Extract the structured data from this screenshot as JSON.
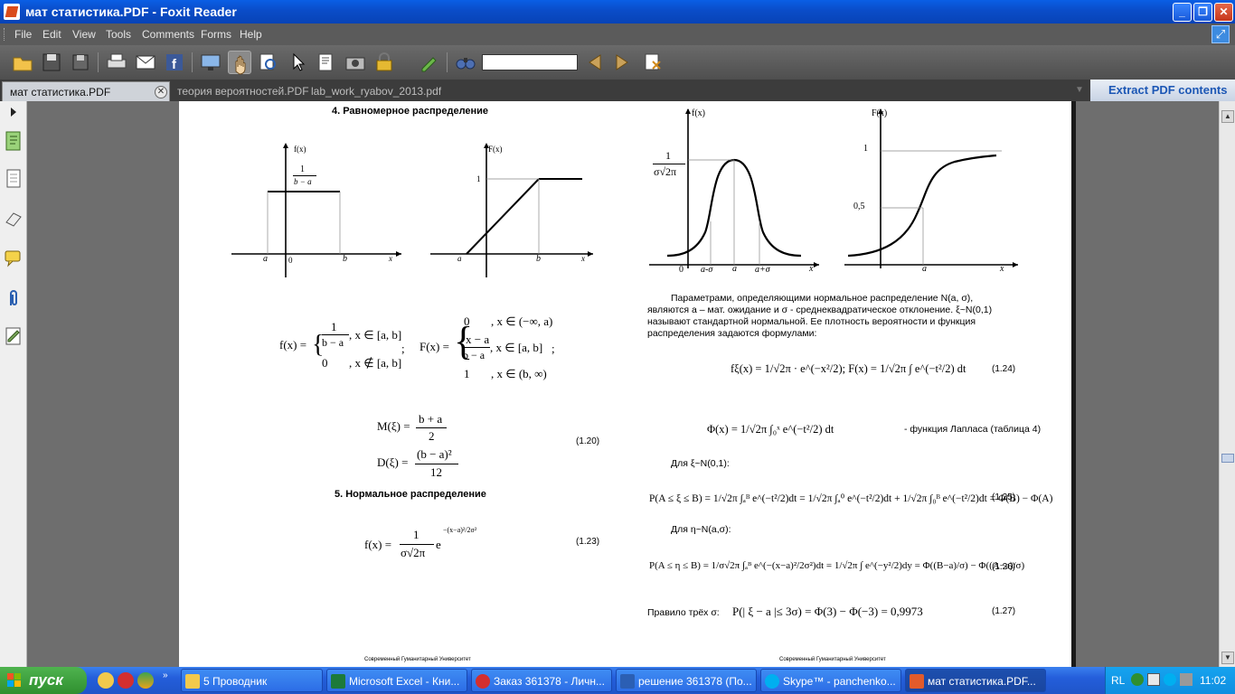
{
  "window": {
    "title": "мат статистика.PDF - Foxit Reader",
    "minimize": "_",
    "maximize": "❐",
    "close": "✕"
  },
  "menu": [
    "File",
    "Edit",
    "View",
    "Tools",
    "Comments",
    "Forms",
    "Help"
  ],
  "toolbar": {
    "find_value": ""
  },
  "tabs": [
    {
      "label": "мат статистика.PDF",
      "active": true
    },
    {
      "label": "теория вероятностей.PDF",
      "active": false
    },
    {
      "label": "lab_work_ryabov_2013.pdf",
      "active": false
    }
  ],
  "extract_label": "Extract PDF contents",
  "doc": {
    "h4": "4.  Равномерное  распределение",
    "h5": "5.  Нормальное  распределение",
    "u_fx_label": "f(x)",
    "u_Fx_label": "F(x)",
    "u_frac": "1",
    "u_frac_den": "b − a",
    "u_a": "a",
    "u_0": "0",
    "u_b": "b",
    "u_x": "x",
    "u_1": "1",
    "u_a2": "a",
    "u_b2": "b",
    "u_x2": "x",
    "f_def": "f(x) =",
    "f_case1": "1",
    "f_case1_den": "b − a",
    "f_case1_cond": ", x ∈ [a, b]",
    "f_case2": "0",
    "f_case2_cond": ", x ∉ [a, b]",
    "f_semicolon": ";",
    "F_def": "F(x) =",
    "F_case1": "0",
    "F_case1_cond": ", x ∈ (−∞, a)",
    "F_case2_num": "x − a",
    "F_case2_den": "b − a",
    "F_case2_cond": ", x ∈ [a, b]",
    "F_case3": "1",
    "F_case3_cond": ", x ∈ (b, ∞)",
    "F_semicolon": ";",
    "M_lhs": "M(ξ) =",
    "M_num": "b + a",
    "M_den": "2",
    "D_lhs": "D(ξ) =",
    "D_num": "(b − a)²",
    "D_den": "12",
    "eq120": "(1.20)",
    "normal_lhs": "f(x) =",
    "normal_num": "1",
    "normal_den": "σ√2π",
    "normal_e": "e",
    "normal_exp": "−(x−a)²/2σ²",
    "eq123": "(1.23)",
    "n_fx_label": "f(x)",
    "n_Fx_label": "F(x)",
    "n_peak_num": "1",
    "n_peak_den": "σ√2π",
    "n_0": "0",
    "n_a_minus": "a-σ",
    "n_a": "a",
    "n_a_plus": "a+σ",
    "n_x": "x",
    "n_1": "1",
    "n_05": "0,5",
    "n_a2": "a",
    "n_x2": "x",
    "para": "Параметрами, определяющими нормальное распределение N(a, σ),",
    "para2": "являются a – мат. ожидание и σ - среднеквадратическое отклонение. ξ~N(0,1)",
    "para3": "называют стандартной нормальной. Ее плотность вероятности и функция",
    "para4": "распределения задаются формулами:",
    "std_f": "fξ(x) = 1/√2π · e^(−x²/2);   F(x) = 1/√2π ∫ e^(−t²/2) dt",
    "eq124": "(1.24)",
    "laplace": "Φ(x) = 1/√2π ∫₀ˣ e^(−t²/2) dt",
    "laplace_tail": "- функция Лапласа (таблица 4)",
    "for_xi": "Для  ξ~N(0,1):",
    "p_xi": "P(A ≤ ξ ≤ B) = 1/√2π ∫ₐᴮ e^(−t²/2)dt = 1/√2π ∫ₐ⁰ e^(−t²/2)dt + 1/√2π ∫₀ᴮ e^(−t²/2)dt = Φ(B) − Φ(A)",
    "eq125": "(1.25)",
    "for_eta": "Для  η~N(a,σ):",
    "p_eta": "P(A ≤ η ≤ B) = 1/σ√2π ∫ₐᴮ e^(−(x−a)²/2σ²)dt = 1/√2π ∫ e^(−y²/2)dy = Φ((B−a)/σ) − Φ((A−a)/σ)",
    "eq126": "(1.26)",
    "rule_label": "Правило трёх  σ:",
    "rule": "P(| ξ − a |≤ 3σ) = Φ(3) − Φ(−3) = 0,9973",
    "eq127": "(1.27)",
    "footer1": "Современный Гуманитарный Университет",
    "footer2": "Современный Гуманитарный Университет"
  },
  "taskbar": {
    "start": "пуск",
    "buttons": [
      {
        "label": "5 Проводник",
        "active": false
      },
      {
        "label": "Microsoft Excel - Кни...",
        "active": false
      },
      {
        "label": "Заказ 361378 - Личн...",
        "active": false
      },
      {
        "label": "решение 361378 (По...",
        "active": false
      },
      {
        "label": "Skype™ - panchenko...",
        "active": false
      },
      {
        "label": "мат статистика.PDF...",
        "active": true
      }
    ],
    "lang": "RL",
    "clock": "11:02"
  }
}
